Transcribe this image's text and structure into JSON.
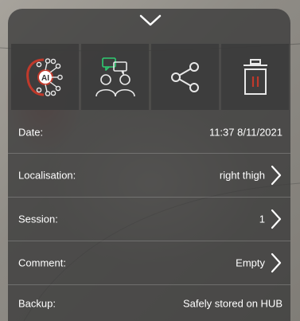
{
  "colors": {
    "accent_red": "#c0392b",
    "icon_stroke": "#e8e8e8",
    "panel_bg": "#3a3a3a"
  },
  "actions": [
    {
      "name": "ai-analysis",
      "icon": "ai-brain-icon",
      "icon_label": "AI"
    },
    {
      "name": "consult",
      "icon": "consult-people-chat-icon"
    },
    {
      "name": "share",
      "icon": "share-icon"
    },
    {
      "name": "delete",
      "icon": "trash-icon"
    }
  ],
  "details": {
    "date": {
      "label": "Date:",
      "value": "11:37 8/11/2021"
    },
    "localisation": {
      "label": "Localisation:",
      "value": "right thigh"
    },
    "session": {
      "label": "Session:",
      "value": "1"
    },
    "comment": {
      "label": "Comment:",
      "value": "Empty"
    },
    "backup": {
      "label": "Backup:",
      "value": "Safely stored on HUB"
    }
  }
}
